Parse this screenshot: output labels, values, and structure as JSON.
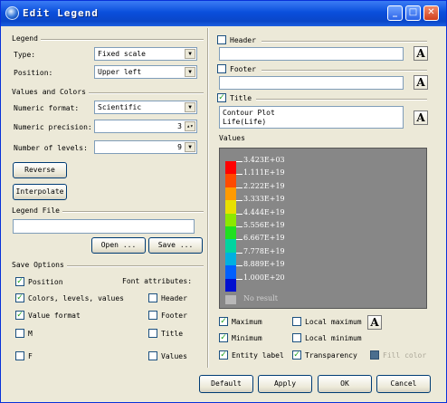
{
  "window": {
    "title": "Edit Legend",
    "minimize": "_",
    "maximize": "□",
    "close": "✕"
  },
  "legend": {
    "group": "Legend",
    "type_label": "Type:",
    "type_value": "Fixed scale",
    "position_label": "Position:",
    "position_value": "Upper left"
  },
  "values_colors": {
    "group": "Values and Colors",
    "numeric_format_label": "Numeric format:",
    "numeric_format_value": "Scientific",
    "numeric_precision_label": "Numeric precision:",
    "numeric_precision_value": "3",
    "levels_label": "Number of levels:",
    "levels_value": "9",
    "reverse_button": "Reverse",
    "interpolate_button": "Interpolate"
  },
  "legend_file": {
    "group": "Legend File",
    "path_value": "",
    "open_button": "Open ...",
    "save_button": "Save ..."
  },
  "save_options": {
    "group": "Save Options",
    "font_attributes": "Font attributes:",
    "position": "Position",
    "colors_levels_values": "Colors, levels, values",
    "value_format": "Value format",
    "m_item": "M",
    "f_item": "F",
    "header": "Header",
    "footer": "Footer",
    "title": "Title",
    "values": "Values"
  },
  "header": {
    "label": "Header",
    "value": "",
    "font_button": "A"
  },
  "footer": {
    "label": "Footer",
    "value": "",
    "font_button": "A"
  },
  "title": {
    "label": "Title",
    "line1": "Contour Plot",
    "line2": "Life(Life)",
    "font_button": "A"
  },
  "values_section": {
    "label": "Values"
  },
  "legend_scale": {
    "labels": [
      "3.423E+03",
      "1.111E+19",
      "2.222E+19",
      "3.333E+19",
      "4.444E+19",
      "5.556E+19",
      "6.667E+19",
      "7.778E+19",
      "8.889E+19",
      "1.000E+20"
    ],
    "colors": [
      "#ff0000",
      "#ff4a00",
      "#ff9a00",
      "#e8e000",
      "#8ce800",
      "#20e020",
      "#00d4a0",
      "#00b0e0",
      "#0060ff",
      "#0010d0"
    ],
    "no_result": "No result",
    "no_result_color": "#b8b8b8",
    "background_color": "#878787"
  },
  "options": {
    "maximum": "Maximum",
    "local_maximum": "Local maximum",
    "minimum": "Minimum",
    "local_minimum": "Local minimum",
    "entity_label": "Entity label",
    "transparency": "Transparency",
    "fill_color": "Fill color",
    "font_button": "A"
  },
  "buttons": {
    "default": "Default",
    "apply": "Apply",
    "ok": "OK",
    "cancel": "Cancel"
  }
}
